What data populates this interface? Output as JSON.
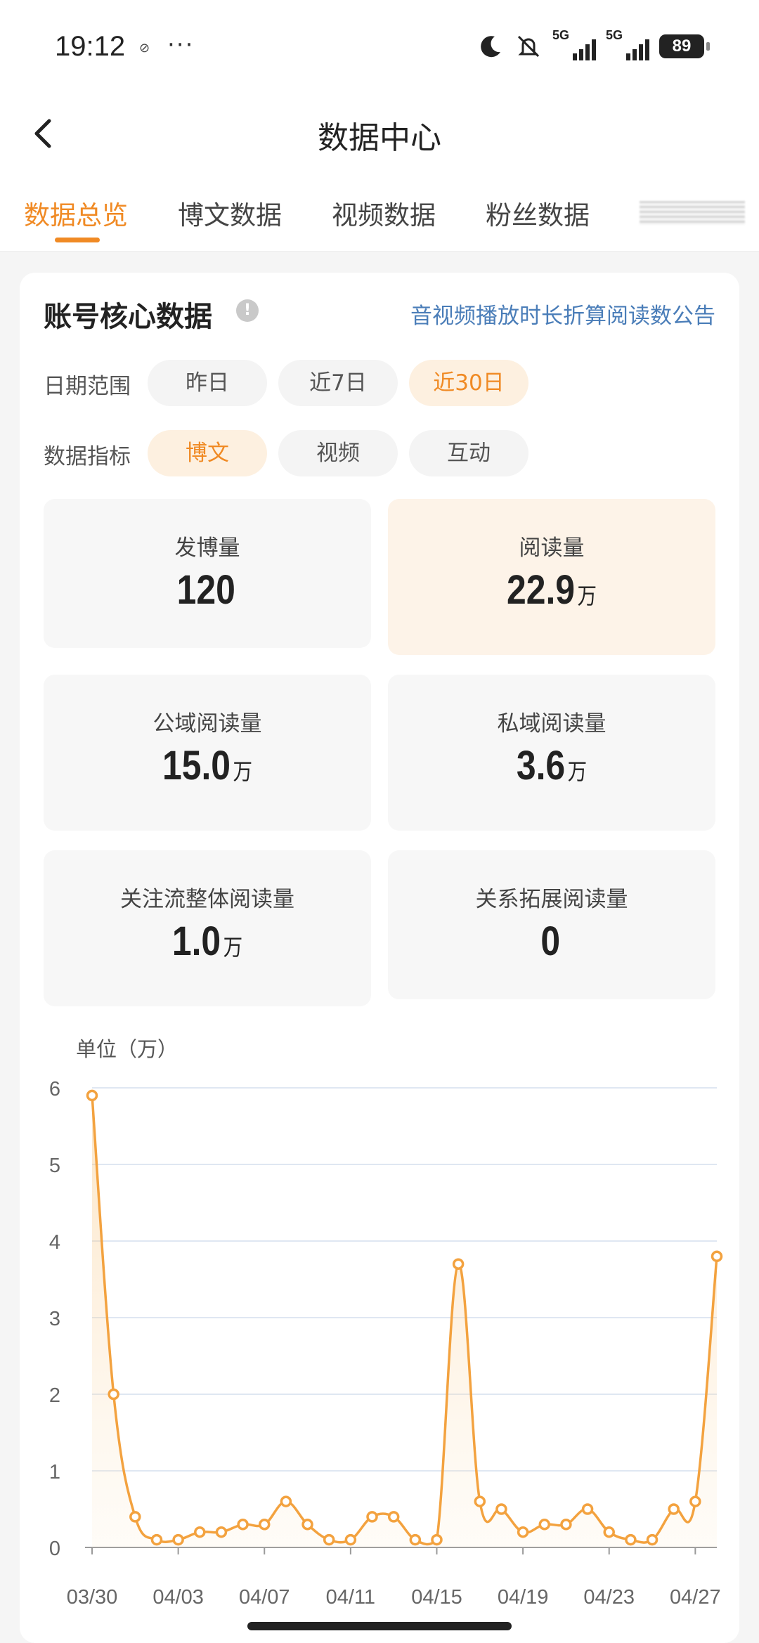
{
  "status_bar": {
    "time": "19:12",
    "net1": "5G",
    "net2": "5G",
    "battery": "89",
    "icons": [
      "moon-icon",
      "mute-icon",
      "signal-icon",
      "battery-icon"
    ]
  },
  "nav": {
    "title": "数据中心"
  },
  "tabs": [
    {
      "label": "数据总览",
      "active": true
    },
    {
      "label": "博文数据",
      "active": false
    },
    {
      "label": "视频数据",
      "active": false
    },
    {
      "label": "粉丝数据",
      "active": false
    }
  ],
  "card": {
    "title": "账号核心数据",
    "notice_link": "音视频播放时长折算阅读数公告"
  },
  "filters": {
    "date_label": "日期范围",
    "date_options": [
      "昨日",
      "近7日",
      "近30日"
    ],
    "date_selected": "近30日",
    "metric_label": "数据指标",
    "metric_options": [
      "博文",
      "视频",
      "互动"
    ],
    "metric_selected": "博文"
  },
  "stats": [
    {
      "label": "发博量",
      "value": "120",
      "unit": ""
    },
    {
      "label": "阅读量",
      "value": "22.9",
      "unit": "万"
    },
    {
      "label": "公域阅读量",
      "value": "15.0",
      "unit": "万"
    },
    {
      "label": "私域阅读量",
      "value": "3.6",
      "unit": "万"
    },
    {
      "label": "关注流整体阅读量",
      "value": "1.0",
      "unit": "万"
    },
    {
      "label": "关系拓展阅读量",
      "value": "0",
      "unit": ""
    }
  ],
  "colors": {
    "accent": "#f08a24",
    "link": "#4a7db8",
    "highlight_bg": "#fdf3e8"
  },
  "chart_data": {
    "type": "line",
    "unit_label": "单位（万）",
    "x_tick_labels": [
      "03/30",
      "04/03",
      "04/07",
      "04/11",
      "04/15",
      "04/19",
      "04/23",
      "04/27"
    ],
    "x_tick_index": [
      0,
      4,
      8,
      12,
      16,
      20,
      24,
      28
    ],
    "y_ticks": [
      0,
      1,
      2,
      3,
      4,
      5,
      6
    ],
    "ylim": [
      0,
      6
    ],
    "grid": true,
    "x": [
      "03/30",
      "03/31",
      "04/01",
      "04/02",
      "04/03",
      "04/04",
      "04/05",
      "04/06",
      "04/07",
      "04/08",
      "04/09",
      "04/10",
      "04/11",
      "04/12",
      "04/13",
      "04/14",
      "04/15",
      "04/16",
      "04/17",
      "04/18",
      "04/19",
      "04/20",
      "04/21",
      "04/22",
      "04/23",
      "04/24",
      "04/25",
      "04/26",
      "04/27",
      "04/28"
    ],
    "values": [
      5.9,
      2.0,
      0.4,
      0.1,
      0.1,
      0.2,
      0.2,
      0.3,
      0.3,
      0.6,
      0.3,
      0.1,
      0.1,
      0.4,
      0.4,
      0.1,
      0.1,
      3.7,
      0.6,
      0.5,
      0.2,
      0.3,
      0.3,
      0.5,
      0.2,
      0.1,
      0.1,
      0.5,
      0.6,
      3.8
    ]
  }
}
